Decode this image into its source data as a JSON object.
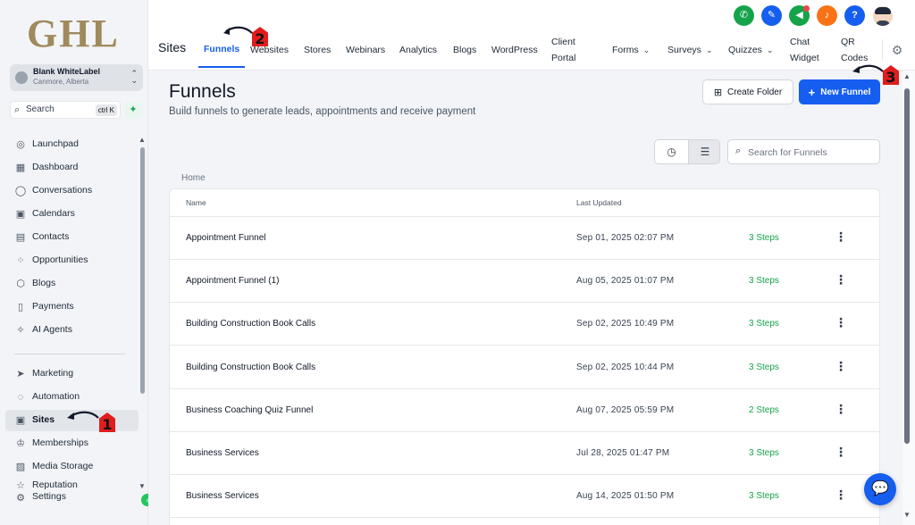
{
  "brand": {
    "logo_text": "GHL"
  },
  "account": {
    "name": "Blank WhiteLabel",
    "location": "Canmore, Alberta"
  },
  "sidebar": {
    "search_label": "Search",
    "search_shortcut": "ctrl K",
    "items": [
      {
        "label": "Launchpad",
        "icon": "rocket-icon"
      },
      {
        "label": "Dashboard",
        "icon": "dashboard-icon"
      },
      {
        "label": "Conversations",
        "icon": "chat-icon"
      },
      {
        "label": "Calendars",
        "icon": "calendar-icon"
      },
      {
        "label": "Contacts",
        "icon": "contacts-icon"
      },
      {
        "label": "Opportunities",
        "icon": "opportunities-icon"
      },
      {
        "label": "Blogs",
        "icon": "blogs-icon"
      },
      {
        "label": "Payments",
        "icon": "payments-icon"
      },
      {
        "label": "AI Agents",
        "icon": "sparkles-icon"
      },
      {
        "label": "Marketing",
        "icon": "send-icon"
      },
      {
        "label": "Automation",
        "icon": "automation-icon"
      },
      {
        "label": "Sites",
        "icon": "sites-icon",
        "active": true
      },
      {
        "label": "Memberships",
        "icon": "memberships-icon"
      },
      {
        "label": "Media Storage",
        "icon": "media-icon"
      },
      {
        "label": "Reputation",
        "icon": "reputation-icon"
      },
      {
        "label": "Settings",
        "icon": "settings-icon"
      }
    ]
  },
  "header": {
    "section": "Sites",
    "tabs": [
      {
        "label": "Funnels",
        "active": true
      },
      {
        "label": "Websites"
      },
      {
        "label": "Stores"
      },
      {
        "label": "Webinars"
      },
      {
        "label": "Analytics"
      },
      {
        "label": "Blogs"
      },
      {
        "label": "WordPress"
      },
      {
        "label_line1": "Client",
        "label_line2": "Portal"
      },
      {
        "label": "Forms",
        "dropdown": true
      },
      {
        "label": "Surveys",
        "dropdown": true
      },
      {
        "label": "Quizzes",
        "dropdown": true
      },
      {
        "label_line1": "Chat",
        "label_line2": "Widget"
      },
      {
        "label_line1": "QR",
        "label_line2": "Codes"
      }
    ],
    "icons": [
      {
        "name": "phone-icon",
        "color": "#16a34a"
      },
      {
        "name": "magic-wand-icon",
        "color": "#155eef"
      },
      {
        "name": "megaphone-icon",
        "color": "#16a34a"
      },
      {
        "name": "bell-icon",
        "color": "#f97316"
      },
      {
        "name": "help-icon",
        "color": "#155eef"
      }
    ]
  },
  "page": {
    "title": "Funnels",
    "subtitle": "Build funnels to generate leads, appointments and receive payment",
    "create_folder": "Create Folder",
    "new_funnel": "New Funnel",
    "search_placeholder": "Search for Funnels",
    "breadcrumb": "Home"
  },
  "table": {
    "columns": {
      "name": "Name",
      "updated": "Last Updated"
    },
    "rows": [
      {
        "name": "Appointment Funnel",
        "updated": "Sep 01, 2025 02:07 PM",
        "steps": "3 Steps"
      },
      {
        "name": "Appointment Funnel (1)",
        "updated": "Aug 05, 2025 01:07 PM",
        "steps": "3 Steps"
      },
      {
        "name": "Building Construction Book Calls",
        "updated": "Sep 02, 2025 10:49 PM",
        "steps": "3 Steps"
      },
      {
        "name": "Building Construction Book Calls",
        "updated": "Sep 02, 2025 10:44 PM",
        "steps": "3 Steps"
      },
      {
        "name": "Business Coaching Quiz Funnel",
        "updated": "Aug 07, 2025 05:59 PM",
        "steps": "2 Steps"
      },
      {
        "name": "Business Services",
        "updated": "Jul 28, 2025 01:47 PM",
        "steps": "3 Steps"
      },
      {
        "name": "Business Services",
        "updated": "Aug 14, 2025 01:50 PM",
        "steps": "3 Steps"
      }
    ]
  },
  "annotations": {
    "marker_1": "1",
    "marker_2": "2",
    "marker_3": "3"
  },
  "colors": {
    "accent": "#155eef",
    "steps_green": "#16a34a",
    "marker_red": "#e11d1d"
  }
}
